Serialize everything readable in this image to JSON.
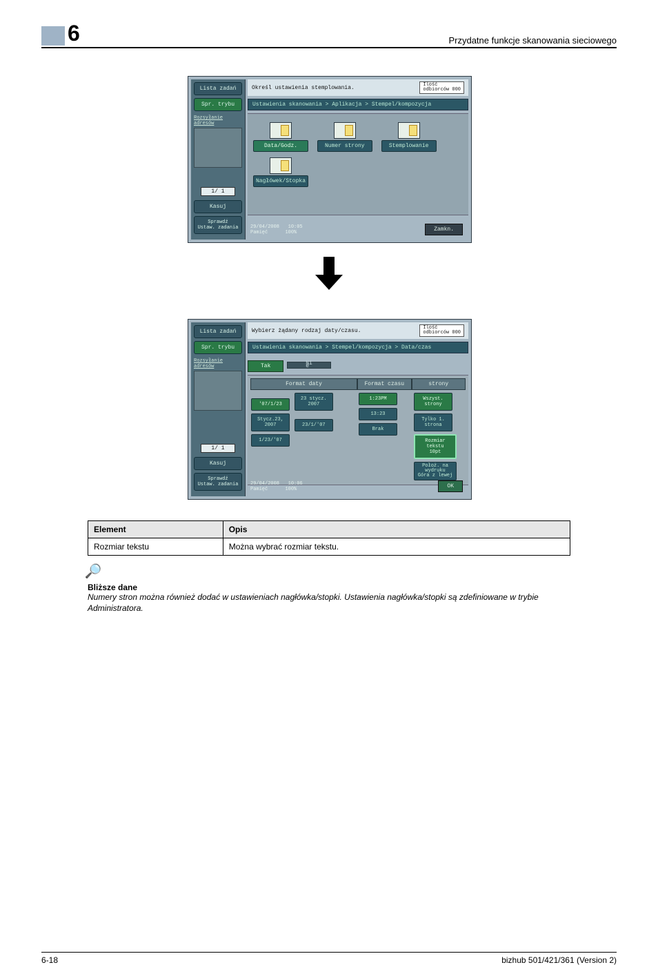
{
  "header": {
    "chapter": "6",
    "section_title": "Przydatne funkcje skanowania sieciowego"
  },
  "lcd1": {
    "side": {
      "lista_zadan": "Lista zadań",
      "spr_trybu": "Spr. trybu",
      "rozsylanie": "Rozsyłanie\nadresów",
      "page": "1/  1",
      "kasuj": "Kasuj",
      "sprawdz": "Sprawdź\nUstaw. zadania"
    },
    "title": "Określ ustawienia stemplowania.",
    "badge": "Ilość\nodbiorców  000",
    "breadcrumb": "Ustawienia skanowania > Aplikacja > Stempel/kompozycja",
    "btns": {
      "data_godz": "Data/Godz.",
      "numer_strony": "Numer strony",
      "stemplowanie": "Stemplowanie",
      "naglowek": "Nagłówek/Stopka"
    },
    "footer": {
      "date": "29/04/2008",
      "time": "10:05",
      "mem": "Pamięć",
      "mem_pct": "100%",
      "close": "Zamkn."
    }
  },
  "lcd2": {
    "title": "Wybierz żądany rodzaj daty/czasu.",
    "badge": "Ilość\nodbiorców  000",
    "breadcrumb": "Ustawienia skanowania > Stempel/kompozycja > Data/czas",
    "tabs": {
      "tak": "Tak",
      "nie": "Ni\ne"
    },
    "heads": {
      "format_daty": "Format daty",
      "format_czasu": "Format czasu",
      "strony": "strony"
    },
    "col1": {
      "a": "'07/1/23",
      "b": "23 stycz. 2007",
      "c": "Stycz.23, 2007",
      "d": "23/1/'07",
      "e": "1/23/'07"
    },
    "col2": {
      "a": "1:23PM",
      "b": "13:23",
      "c": "Brak"
    },
    "col3": {
      "a": "Wszyst. strony",
      "b": "Tylko 1.\nstrona",
      "c": "Rozmiar tekstu\n10pt",
      "d": "Położ. na\nwydruku\nGóra z lewej"
    },
    "footer": {
      "date": "29/04/2008",
      "time": "10:06",
      "mem": "Pamięć",
      "mem_pct": "100%",
      "ok": "OK"
    }
  },
  "table": {
    "h_element": "Element",
    "h_opis": "Opis",
    "r1_el": "Rozmiar tekstu",
    "r1_op": "Można wybrać rozmiar tekstu."
  },
  "note": {
    "heading": "Bliższe dane",
    "text": "Numery stron można również dodać w ustawieniach nagłówka/stopki. Ustawienia nagłówka/stopki są zdefiniowane w trybie Administratora."
  },
  "page_footer": {
    "left": "6-18",
    "right": "bizhub 501/421/361 (Version 2)"
  }
}
